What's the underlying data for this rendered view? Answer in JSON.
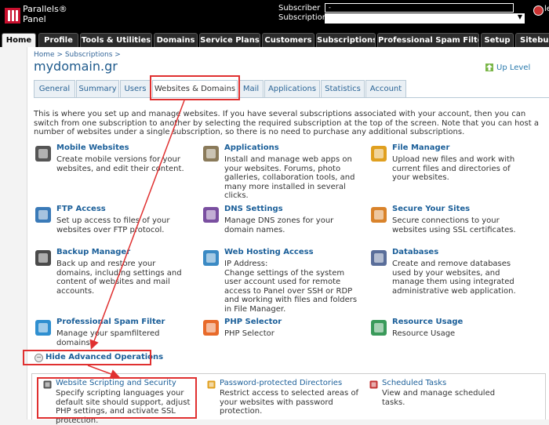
{
  "header": {
    "logo_line1": "Parallels®",
    "logo_line2": "Panel",
    "subscriber_label": "Subscriber",
    "subscription_label": "Subscription",
    "subscriber_value": "-",
    "user_text": "le"
  },
  "nav": {
    "tabs": [
      "Home",
      "Profile",
      "Tools & Utilities",
      "Domains",
      "Service Plans",
      "Customers",
      "Subscriptions",
      "Professional Spam Filter",
      "Setup",
      "Sitebuild"
    ]
  },
  "breadcrumb": "Home > Subscriptions >",
  "page_title": "mydomain.gr",
  "up_level": "Up Level",
  "tabs": [
    "General",
    "Summary",
    "Users",
    "Websites & Domains",
    "Mail",
    "Applications",
    "Statistics",
    "Account"
  ],
  "intro": "This is where you set up and manage websites. If you have several subscriptions associated with your account, then you can switch from one subscription to another by selecting the required subscription at the top of the screen. Note that you can host a number of websites under a single subscription, so there is no need to purchase any additional subscriptions.",
  "tools": [
    {
      "title": "Mobile Websites",
      "desc": "Create mobile versions for your websites, and edit their content.",
      "icon": "mobile-icon",
      "color": "#555555"
    },
    {
      "title": "Applications",
      "desc": "Install and manage web apps on your websites. Forums, photo galleries, collaboration tools, and many more installed in several clicks.",
      "icon": "applications-icon",
      "color": "#8a7a5a"
    },
    {
      "title": "File Manager",
      "desc": "Upload new files and work with current files and directories of your websites.",
      "icon": "folder-icon",
      "color": "#e0a020"
    },
    {
      "title": "FTP Access",
      "desc": "Set up access to files of your websites over FTP protocol.",
      "icon": "ftp-icon",
      "color": "#3a7ab8"
    },
    {
      "title": "DNS Settings",
      "desc": "Manage DNS zones for your domain names.",
      "icon": "dns-icon",
      "color": "#7a4fa0"
    },
    {
      "title": "Secure Your Sites",
      "desc": "Secure connections to your websites using SSL certificates.",
      "icon": "certificate-icon",
      "color": "#d9832b"
    },
    {
      "title": "Backup Manager",
      "desc": "Back up and restore your domains, including settings and content of websites and mail accounts.",
      "icon": "backup-icon",
      "color": "#4a4a4a"
    },
    {
      "title": "Web Hosting Access",
      "desc": "IP Address:\nChange settings of the system user account used for remote access to Panel over SSH or RDP and working with files and folders in File Manager.",
      "icon": "globe-icon",
      "color": "#3b8ac4"
    },
    {
      "title": "Databases",
      "desc": "Create and remove databases used by your websites, and manage them using integrated administrative web application.",
      "icon": "database-icon",
      "color": "#5a6e9a"
    },
    {
      "title": "Professional Spam Filter",
      "desc": "Manage your spamfiltered domains",
      "icon": "spam-filter-icon",
      "color": "#2f8fd0"
    },
    {
      "title": "PHP Selector",
      "desc": "PHP Selector",
      "icon": "php-icon",
      "color": "#e86a2a"
    },
    {
      "title": "Resource Usage",
      "desc": "Resource Usage",
      "icon": "chart-icon",
      "color": "#3a9a5a"
    }
  ],
  "advanced_toggle": "Hide Advanced Operations",
  "advanced": [
    {
      "title": "Website Scripting and Security",
      "desc": "Specify scripting languages your default site should support, adjust PHP settings, and activate SSL protection.",
      "icon": "scripting-icon"
    },
    {
      "title": "Password-protected Directories",
      "desc": "Restrict access to selected areas of your websites with password protection.",
      "icon": "lock-icon"
    },
    {
      "title": "Scheduled Tasks",
      "desc": "View and manage scheduled tasks.",
      "icon": "calendar-icon"
    }
  ]
}
